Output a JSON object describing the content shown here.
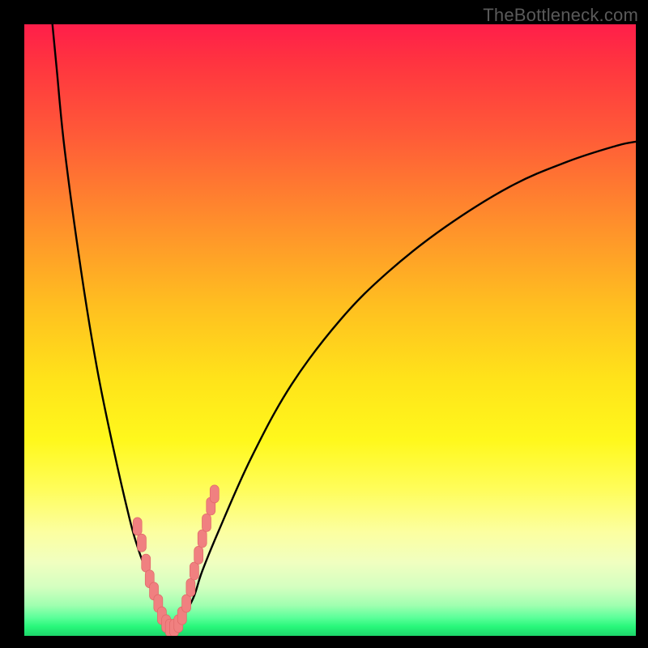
{
  "watermark": "TheBottleneck.com",
  "colors": {
    "curve": "#000000",
    "marker_fill": "#f08080",
    "marker_stroke": "#e06868",
    "frame_bg": "#000000"
  },
  "chart_data": {
    "type": "line",
    "title": "",
    "xlabel": "",
    "ylabel": "",
    "xlim": [
      0,
      100
    ],
    "ylim": [
      0,
      100
    ],
    "grid": false,
    "note": "Bottleneck-style V curve; y is bottleneck % (0 at minimum), x is relative component scale. Values estimated from pixel positions; axes are unlabeled in the source image.",
    "series": [
      {
        "name": "curve-left",
        "x": [
          4.6,
          5.3,
          6.6,
          9.3,
          11.9,
          14.6,
          17.2,
          18.5,
          19.9,
          21.2,
          22.5,
          23.2,
          23.8
        ],
        "y": [
          100.0,
          92.7,
          79.5,
          59.6,
          43.7,
          30.5,
          19.2,
          14.6,
          10.6,
          6.6,
          4.0,
          2.0,
          0.7
        ]
      },
      {
        "name": "curve-right",
        "x": [
          23.8,
          25.2,
          26.5,
          27.8,
          29.1,
          31.8,
          37.1,
          43.7,
          51.7,
          59.6,
          68.9,
          79.5,
          88.7,
          96.7,
          100.0
        ],
        "y": [
          0.7,
          2.0,
          4.0,
          6.6,
          10.6,
          17.2,
          29.1,
          41.1,
          51.7,
          59.6,
          66.9,
          73.5,
          77.5,
          80.1,
          80.8
        ]
      },
      {
        "name": "markers",
        "type": "scatter",
        "x": [
          18.5,
          19.2,
          19.9,
          20.5,
          21.2,
          21.9,
          22.5,
          23.2,
          23.8,
          24.5,
          25.2,
          25.8,
          26.5,
          27.2,
          27.8,
          28.5,
          29.1,
          29.8,
          30.5,
          31.1
        ],
        "y": [
          17.9,
          15.2,
          11.9,
          9.3,
          7.3,
          5.3,
          3.3,
          2.0,
          1.3,
          1.3,
          2.0,
          3.3,
          5.3,
          7.9,
          10.6,
          13.2,
          15.9,
          18.5,
          21.2,
          23.2
        ]
      }
    ]
  }
}
